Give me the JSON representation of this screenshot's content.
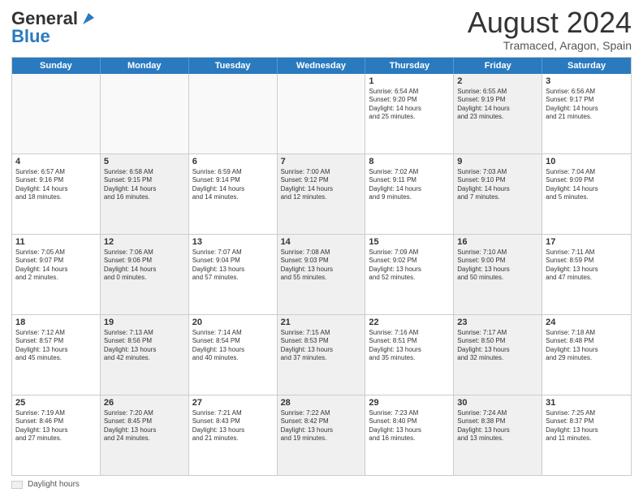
{
  "header": {
    "logo_general": "General",
    "logo_blue": "Blue",
    "month_year": "August 2024",
    "location": "Tramaced, Aragon, Spain"
  },
  "weekdays": [
    "Sunday",
    "Monday",
    "Tuesday",
    "Wednesday",
    "Thursday",
    "Friday",
    "Saturday"
  ],
  "weeks": [
    [
      {
        "day": "",
        "text": "",
        "empty": true
      },
      {
        "day": "",
        "text": "",
        "empty": true
      },
      {
        "day": "",
        "text": "",
        "empty": true
      },
      {
        "day": "",
        "text": "",
        "empty": true
      },
      {
        "day": "1",
        "text": "Sunrise: 6:54 AM\nSunset: 9:20 PM\nDaylight: 14 hours\nand 25 minutes.",
        "empty": false,
        "shaded": false
      },
      {
        "day": "2",
        "text": "Sunrise: 6:55 AM\nSunset: 9:19 PM\nDaylight: 14 hours\nand 23 minutes.",
        "empty": false,
        "shaded": true
      },
      {
        "day": "3",
        "text": "Sunrise: 6:56 AM\nSunset: 9:17 PM\nDaylight: 14 hours\nand 21 minutes.",
        "empty": false,
        "shaded": false
      }
    ],
    [
      {
        "day": "4",
        "text": "Sunrise: 6:57 AM\nSunset: 9:16 PM\nDaylight: 14 hours\nand 18 minutes.",
        "empty": false,
        "shaded": false
      },
      {
        "day": "5",
        "text": "Sunrise: 6:58 AM\nSunset: 9:15 PM\nDaylight: 14 hours\nand 16 minutes.",
        "empty": false,
        "shaded": true
      },
      {
        "day": "6",
        "text": "Sunrise: 6:59 AM\nSunset: 9:14 PM\nDaylight: 14 hours\nand 14 minutes.",
        "empty": false,
        "shaded": false
      },
      {
        "day": "7",
        "text": "Sunrise: 7:00 AM\nSunset: 9:12 PM\nDaylight: 14 hours\nand 12 minutes.",
        "empty": false,
        "shaded": true
      },
      {
        "day": "8",
        "text": "Sunrise: 7:02 AM\nSunset: 9:11 PM\nDaylight: 14 hours\nand 9 minutes.",
        "empty": false,
        "shaded": false
      },
      {
        "day": "9",
        "text": "Sunrise: 7:03 AM\nSunset: 9:10 PM\nDaylight: 14 hours\nand 7 minutes.",
        "empty": false,
        "shaded": true
      },
      {
        "day": "10",
        "text": "Sunrise: 7:04 AM\nSunset: 9:09 PM\nDaylight: 14 hours\nand 5 minutes.",
        "empty": false,
        "shaded": false
      }
    ],
    [
      {
        "day": "11",
        "text": "Sunrise: 7:05 AM\nSunset: 9:07 PM\nDaylight: 14 hours\nand 2 minutes.",
        "empty": false,
        "shaded": false
      },
      {
        "day": "12",
        "text": "Sunrise: 7:06 AM\nSunset: 9:06 PM\nDaylight: 14 hours\nand 0 minutes.",
        "empty": false,
        "shaded": true
      },
      {
        "day": "13",
        "text": "Sunrise: 7:07 AM\nSunset: 9:04 PM\nDaylight: 13 hours\nand 57 minutes.",
        "empty": false,
        "shaded": false
      },
      {
        "day": "14",
        "text": "Sunrise: 7:08 AM\nSunset: 9:03 PM\nDaylight: 13 hours\nand 55 minutes.",
        "empty": false,
        "shaded": true
      },
      {
        "day": "15",
        "text": "Sunrise: 7:09 AM\nSunset: 9:02 PM\nDaylight: 13 hours\nand 52 minutes.",
        "empty": false,
        "shaded": false
      },
      {
        "day": "16",
        "text": "Sunrise: 7:10 AM\nSunset: 9:00 PM\nDaylight: 13 hours\nand 50 minutes.",
        "empty": false,
        "shaded": true
      },
      {
        "day": "17",
        "text": "Sunrise: 7:11 AM\nSunset: 8:59 PM\nDaylight: 13 hours\nand 47 minutes.",
        "empty": false,
        "shaded": false
      }
    ],
    [
      {
        "day": "18",
        "text": "Sunrise: 7:12 AM\nSunset: 8:57 PM\nDaylight: 13 hours\nand 45 minutes.",
        "empty": false,
        "shaded": false
      },
      {
        "day": "19",
        "text": "Sunrise: 7:13 AM\nSunset: 8:56 PM\nDaylight: 13 hours\nand 42 minutes.",
        "empty": false,
        "shaded": true
      },
      {
        "day": "20",
        "text": "Sunrise: 7:14 AM\nSunset: 8:54 PM\nDaylight: 13 hours\nand 40 minutes.",
        "empty": false,
        "shaded": false
      },
      {
        "day": "21",
        "text": "Sunrise: 7:15 AM\nSunset: 8:53 PM\nDaylight: 13 hours\nand 37 minutes.",
        "empty": false,
        "shaded": true
      },
      {
        "day": "22",
        "text": "Sunrise: 7:16 AM\nSunset: 8:51 PM\nDaylight: 13 hours\nand 35 minutes.",
        "empty": false,
        "shaded": false
      },
      {
        "day": "23",
        "text": "Sunrise: 7:17 AM\nSunset: 8:50 PM\nDaylight: 13 hours\nand 32 minutes.",
        "empty": false,
        "shaded": true
      },
      {
        "day": "24",
        "text": "Sunrise: 7:18 AM\nSunset: 8:48 PM\nDaylight: 13 hours\nand 29 minutes.",
        "empty": false,
        "shaded": false
      }
    ],
    [
      {
        "day": "25",
        "text": "Sunrise: 7:19 AM\nSunset: 8:46 PM\nDaylight: 13 hours\nand 27 minutes.",
        "empty": false,
        "shaded": false
      },
      {
        "day": "26",
        "text": "Sunrise: 7:20 AM\nSunset: 8:45 PM\nDaylight: 13 hours\nand 24 minutes.",
        "empty": false,
        "shaded": true
      },
      {
        "day": "27",
        "text": "Sunrise: 7:21 AM\nSunset: 8:43 PM\nDaylight: 13 hours\nand 21 minutes.",
        "empty": false,
        "shaded": false
      },
      {
        "day": "28",
        "text": "Sunrise: 7:22 AM\nSunset: 8:42 PM\nDaylight: 13 hours\nand 19 minutes.",
        "empty": false,
        "shaded": true
      },
      {
        "day": "29",
        "text": "Sunrise: 7:23 AM\nSunset: 8:40 PM\nDaylight: 13 hours\nand 16 minutes.",
        "empty": false,
        "shaded": false
      },
      {
        "day": "30",
        "text": "Sunrise: 7:24 AM\nSunset: 8:38 PM\nDaylight: 13 hours\nand 13 minutes.",
        "empty": false,
        "shaded": true
      },
      {
        "day": "31",
        "text": "Sunrise: 7:25 AM\nSunset: 8:37 PM\nDaylight: 13 hours\nand 11 minutes.",
        "empty": false,
        "shaded": false
      }
    ]
  ],
  "footer": {
    "swatch_label": "Daylight hours"
  }
}
